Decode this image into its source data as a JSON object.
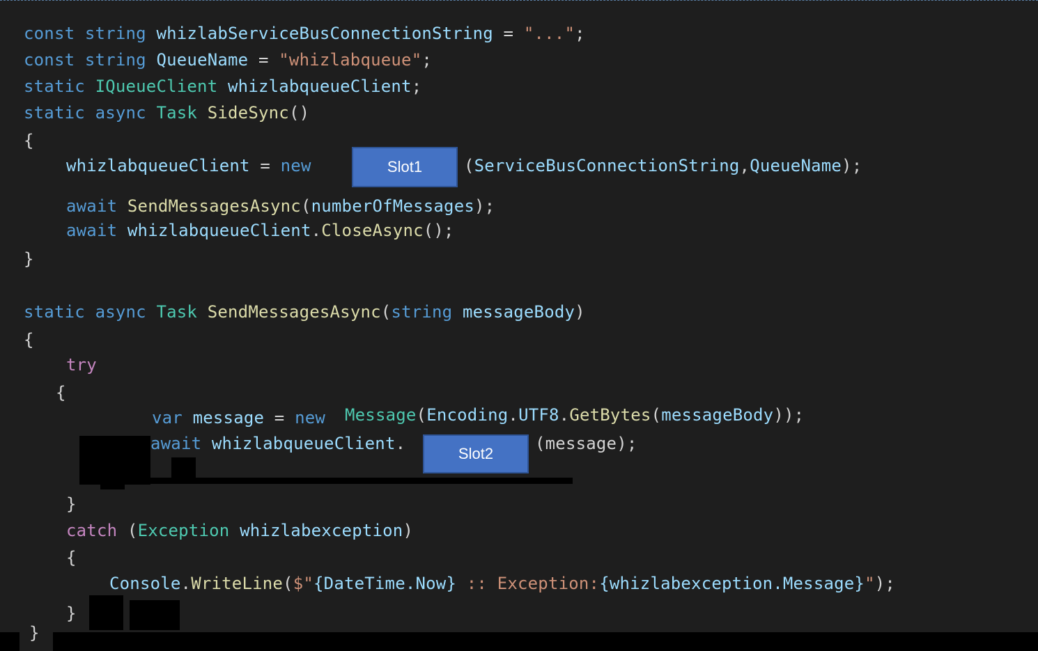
{
  "code": {
    "l1": {
      "k1": "const",
      "k2": "string",
      "v": "whizlabServiceBusConnectionString",
      "op": " = ",
      "s": "\"...\"",
      "end": ";"
    },
    "l2": {
      "k1": "const",
      "k2": "string",
      "v": "QueueName",
      "op": " = ",
      "s": "\"whizlabqueue\"",
      "end": ";"
    },
    "l3": {
      "k1": "static",
      "t": "IQueueClient",
      "v": "whizlabqueueClient",
      "end": ";"
    },
    "l4": {
      "k1": "static",
      "k2": "async",
      "t": "Task",
      "f": "SideSync",
      "p": "()"
    },
    "l5": "{",
    "l6": {
      "v": "whizlabqueueClient",
      "op": " = ",
      "k": "new",
      "rest1": "(",
      "a1": "ServiceBusConnectionString",
      "comma": ",",
      "a2": "QueueName",
      "end": ");"
    },
    "l7": {
      "k": "await",
      "f": "SendMessagesAsync",
      "o": "(",
      "a": "numberOfMessages",
      "end": ");"
    },
    "l8": {
      "k": "await",
      "v": "whizlabqueueClient",
      "dot": ".",
      "f": "CloseAsync",
      "end": "();"
    },
    "l9": "}",
    "l10": {
      "k1": "static",
      "k2": "async",
      "t": "Task",
      "f": "SendMessagesAsync",
      "o": "(",
      "k3": "string",
      "a": "messageBody",
      "end": ")"
    },
    "l11": "{",
    "l12": {
      "k": "try"
    },
    "l13": "{",
    "l14": {
      "k": "var",
      "v": "message",
      "op": " = ",
      "k2": "new",
      "t": "Message",
      "o": "(",
      "v2": "Encoding",
      "d1": ".",
      "v3": "UTF8",
      "d2": ".",
      "f": "GetBytes",
      "o2": "(",
      "a": "messageBody",
      "end": "));"
    },
    "l15": {
      "k": "await",
      "v": "whizlabqueueClient",
      "dot": ".",
      "rest": "(message);"
    },
    "l16": "}",
    "l17": {
      "k": "catch",
      "o": " (",
      "t": "Exception",
      "v": "whizlabexception",
      "end": ")"
    },
    "l18": "{",
    "l19": {
      "v": "Console",
      "d": ".",
      "f": "WriteLine",
      "o": "(",
      "s1": "$\"",
      "i1": "{DateTime.Now}",
      "s2": " :: Exception:",
      "i2": "{whizlabexception.Message}",
      "s3": "\"",
      "end": ");"
    },
    "l20": "}",
    "l21": "}"
  },
  "slots": {
    "slot1": "Slot1",
    "slot2": "Slot2"
  }
}
